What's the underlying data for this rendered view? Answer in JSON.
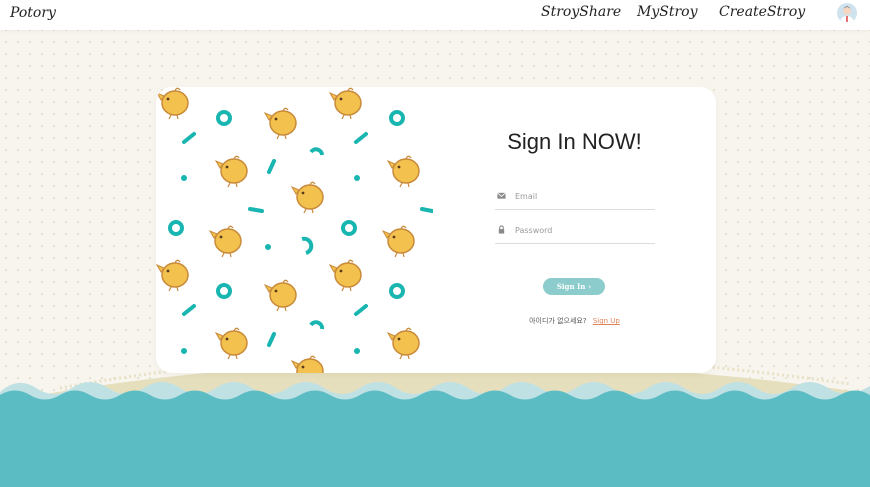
{
  "navbar": {
    "brand": "Potory",
    "links": [
      "StroyShare",
      "MyStroy",
      "CreateStroy"
    ],
    "avatar_icon": "user-avatar-icon"
  },
  "signin": {
    "title": "Sign In NOW!",
    "email_placeholder": "Email",
    "email_value": "",
    "password_placeholder": "Password",
    "password_value": "",
    "button_label": "Sign In",
    "no_account_text": "아이디가 없으세요?",
    "signup_label": "Sign Up"
  },
  "colors": {
    "teal": "#5bbcc3",
    "chick": "#f2c14e",
    "button": "#8ccccc",
    "link": "#e0845a"
  }
}
